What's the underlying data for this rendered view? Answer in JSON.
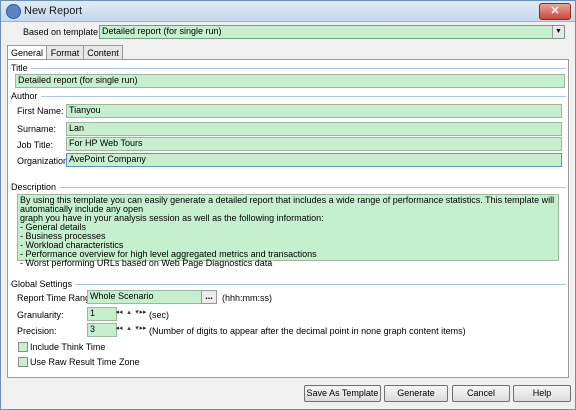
{
  "window": {
    "title": "New Report",
    "close_symbol": "✕"
  },
  "template": {
    "label": "Based on template",
    "value": "Detailed report (for single run)"
  },
  "tabs": [
    {
      "label": "General"
    },
    {
      "label": "Format"
    },
    {
      "label": "Content"
    }
  ],
  "title_section": {
    "heading": "Title",
    "value": "Detailed report (for single run)"
  },
  "author": {
    "heading": "Author",
    "first_name": {
      "label": "First Name:",
      "value": "Tianyou"
    },
    "surname": {
      "label": "Surname:",
      "value": "Lan"
    },
    "job_title": {
      "label": "Job Title:",
      "value": "For HP Web Tours"
    },
    "organization": {
      "label": "Organization:",
      "value": "AvePoint Company"
    }
  },
  "description": {
    "heading": "Description",
    "lines": [
      "By using this template you can easily generate a detailed report that includes a wide range of performance statistics. This template will automatically include any open",
      "graph you have in your analysis session as well as the following information:",
      "- General details",
      "- Business processes",
      "- Workload characteristics",
      "- Performance overview for high level aggregated metrics and transactions",
      "- Worst performing URLs based on Web Page Diagnostics data"
    ]
  },
  "global_settings": {
    "heading": "Global Settings",
    "time_range": {
      "label": "Report Time Range:",
      "value": "Whole Scenario",
      "ellipsis": "...",
      "hint": "(hhh:mm:ss)"
    },
    "granularity": {
      "label": "Granularity:",
      "value": "1",
      "unit": "(sec)"
    },
    "precision": {
      "label": "Precision:",
      "value": "3",
      "hint": "(Number of digits to appear after the decimal point in none graph content items)"
    },
    "include_think_time": {
      "label": "Include Think Time",
      "checked": false
    },
    "raw_result_tz": {
      "label": "Use Raw Result Time Zone",
      "checked": false
    }
  },
  "spin_glyphs": {
    "first": "◂◂",
    "up": "▴",
    "down": "▾",
    "last": "▸▸"
  },
  "buttons": {
    "save_template": "Save As Template",
    "generate": "Generate",
    "cancel": "Cancel",
    "help": "Help"
  },
  "colors": {
    "field_bg": "#c6efce",
    "accent": "#5b8fd6"
  }
}
